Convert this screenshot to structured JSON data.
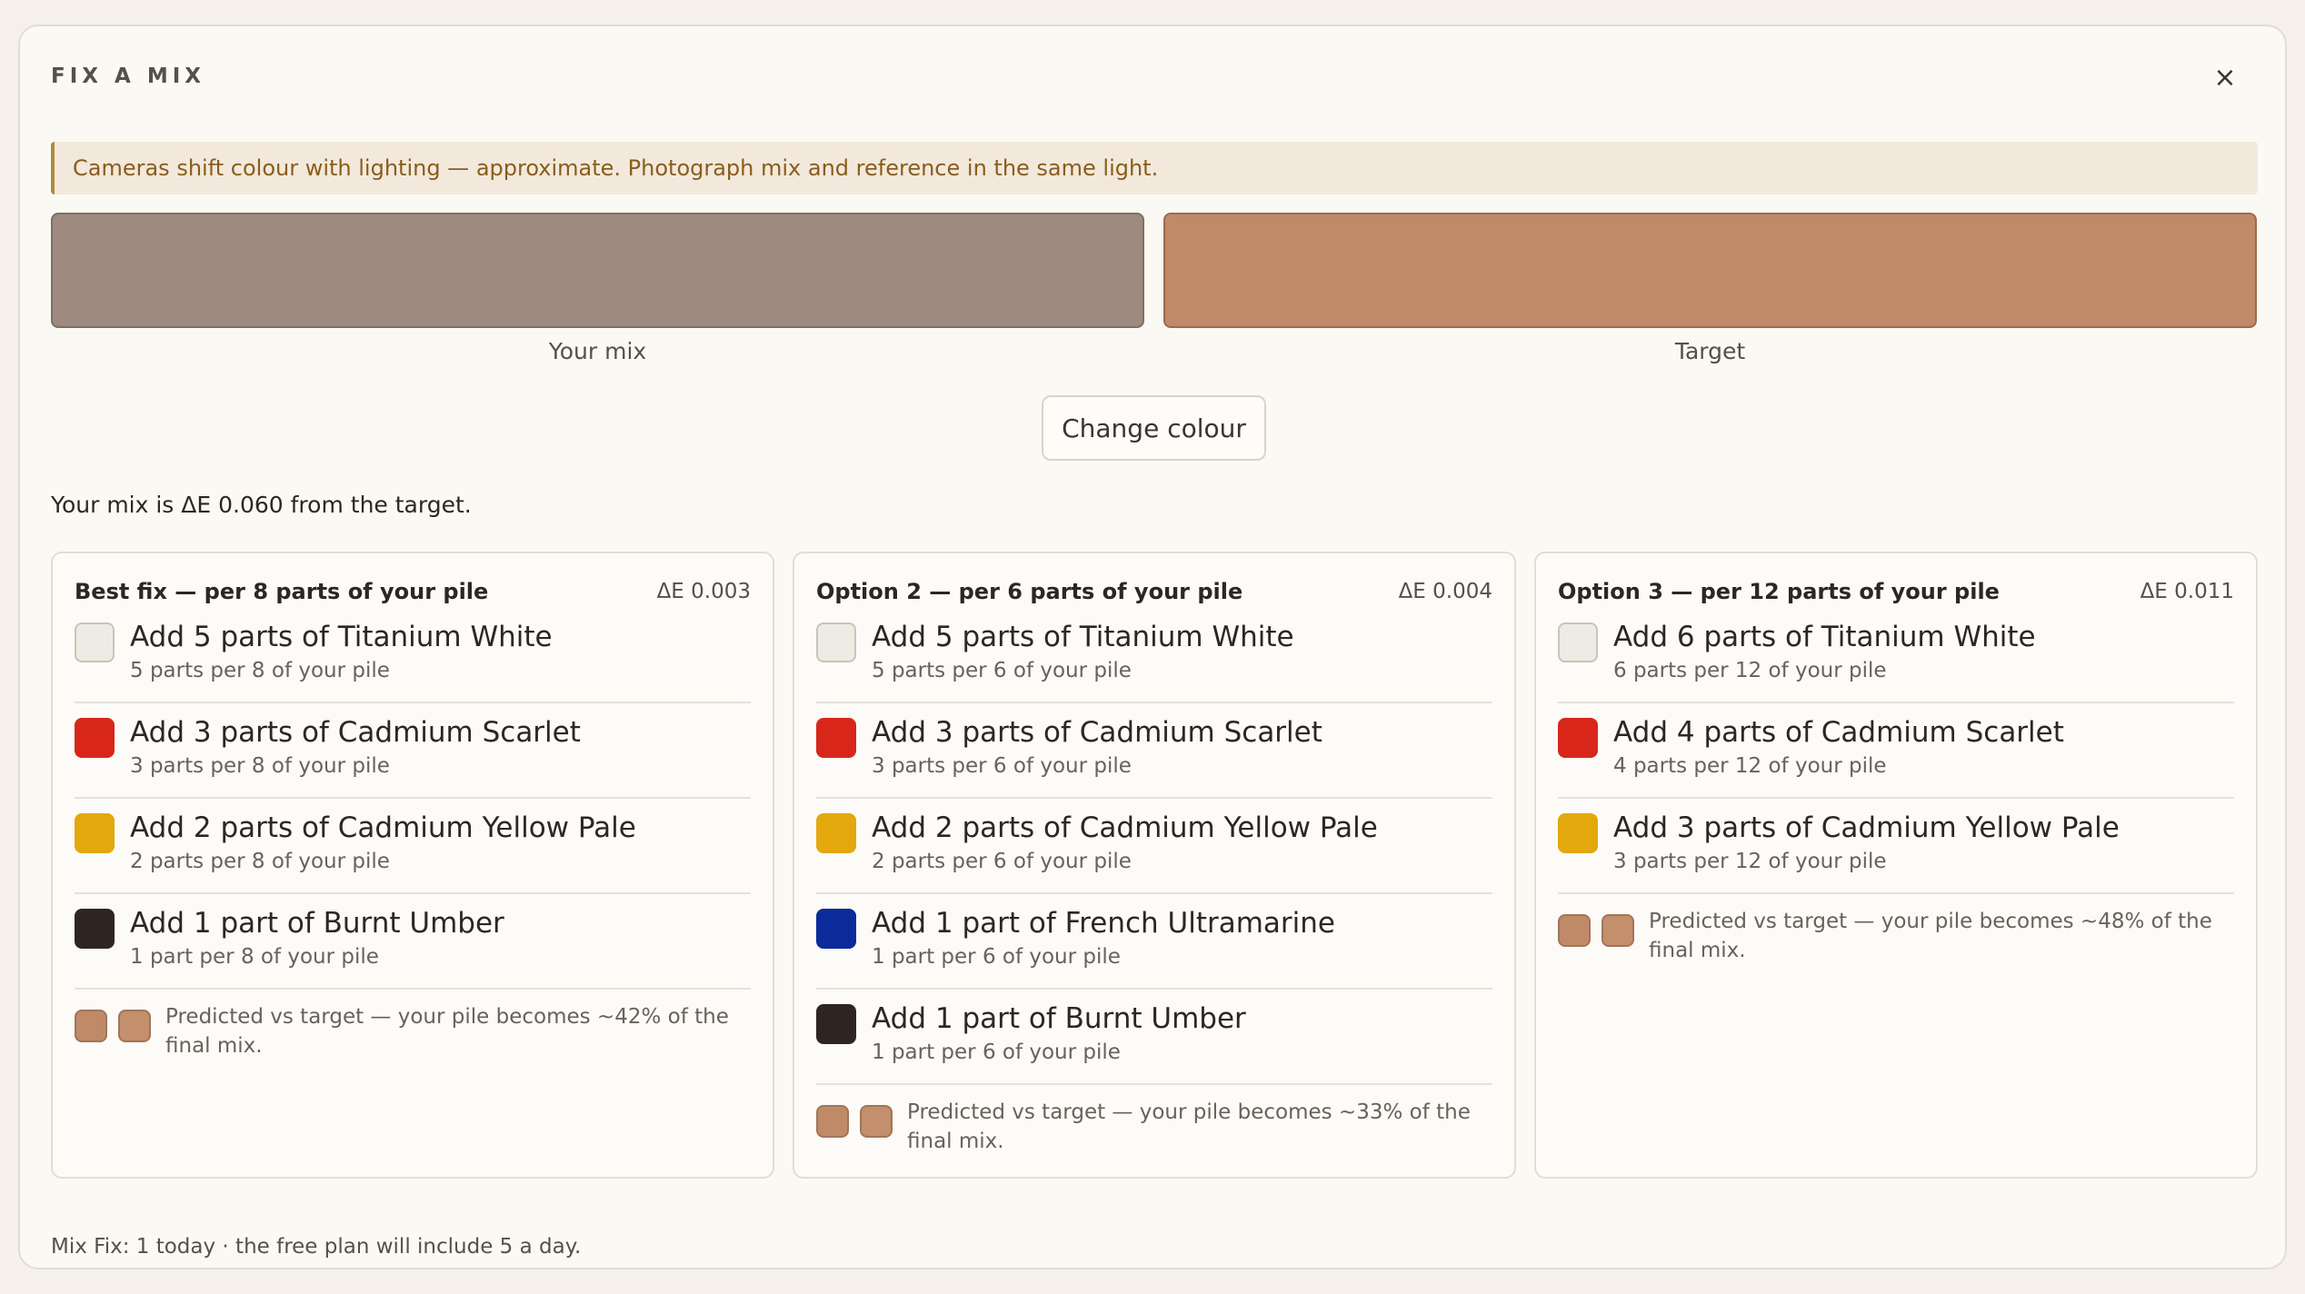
{
  "dialog": {
    "title": "FIX A MIX",
    "close_label": "×",
    "notice": "Cameras shift colour with lighting — approximate. Photograph mix and reference in the same light.",
    "mix_label": "Your mix",
    "target_label": "Target",
    "mix_color": "#9e8a7e",
    "target_color": "#c08a69",
    "change_button": "Change colour",
    "distance_text": "Your mix is ΔE 0.060 from the target.",
    "footer": "Mix Fix: 1 today · the free plan will include 5 a day."
  },
  "paint_colors": {
    "titanium_white": "#eeebe4",
    "cadmium_scarlet": "#d8261b",
    "cadmium_yellow_pale": "#e3a80c",
    "burnt_umber": "#2e2522",
    "french_ultramarine": "#0b2b9a"
  },
  "options": [
    {
      "title": "Best fix — per 8 parts of your pile",
      "delta_e": "ΔE 0.003",
      "steps": [
        {
          "main": "Add 5 parts of Titanium White",
          "sub": "5 parts per 8 of your pile",
          "color": "#eeebe4"
        },
        {
          "main": "Add 3 parts of Cadmium Scarlet",
          "sub": "3 parts per 8 of your pile",
          "color": "#d8261b"
        },
        {
          "main": "Add 2 parts of Cadmium Yellow Pale",
          "sub": "2 parts per 8 of your pile",
          "color": "#e3a80c"
        },
        {
          "main": "Add 1 part of Burnt Umber",
          "sub": "1 part per 8 of your pile",
          "color": "#2e2522"
        }
      ],
      "predicted_text": "Predicted vs target — your pile becomes ~42% of the final mix.",
      "predicted_color": "#c08a69",
      "target_color": "#c38f6c"
    },
    {
      "title": "Option 2 — per 6 parts of your pile",
      "delta_e": "ΔE 0.004",
      "steps": [
        {
          "main": "Add 5 parts of Titanium White",
          "sub": "5 parts per 6 of your pile",
          "color": "#eeebe4"
        },
        {
          "main": "Add 3 parts of Cadmium Scarlet",
          "sub": "3 parts per 6 of your pile",
          "color": "#d8261b"
        },
        {
          "main": "Add 2 parts of Cadmium Yellow Pale",
          "sub": "2 parts per 6 of your pile",
          "color": "#e3a80c"
        },
        {
          "main": "Add 1 part of French Ultramarine",
          "sub": "1 part per 6 of your pile",
          "color": "#0b2b9a"
        },
        {
          "main": "Add 1 part of Burnt Umber",
          "sub": "1 part per 6 of your pile",
          "color": "#2e2522"
        }
      ],
      "predicted_text": "Predicted vs target — your pile becomes ~33% of the final mix.",
      "predicted_color": "#c08a69",
      "target_color": "#c38f6c"
    },
    {
      "title": "Option 3 — per 12 parts of your pile",
      "delta_e": "ΔE 0.011",
      "steps": [
        {
          "main": "Add 6 parts of Titanium White",
          "sub": "6 parts per 12 of your pile",
          "color": "#eeebe4"
        },
        {
          "main": "Add 4 parts of Cadmium Scarlet",
          "sub": "4 parts per 12 of your pile",
          "color": "#d8261b"
        },
        {
          "main": "Add 3 parts of Cadmium Yellow Pale",
          "sub": "3 parts per 12 of your pile",
          "color": "#e3a80c"
        }
      ],
      "predicted_text": "Predicted vs target — your pile becomes ~48% of the final mix.",
      "predicted_color": "#c08a69",
      "target_color": "#c38f6c"
    }
  ]
}
